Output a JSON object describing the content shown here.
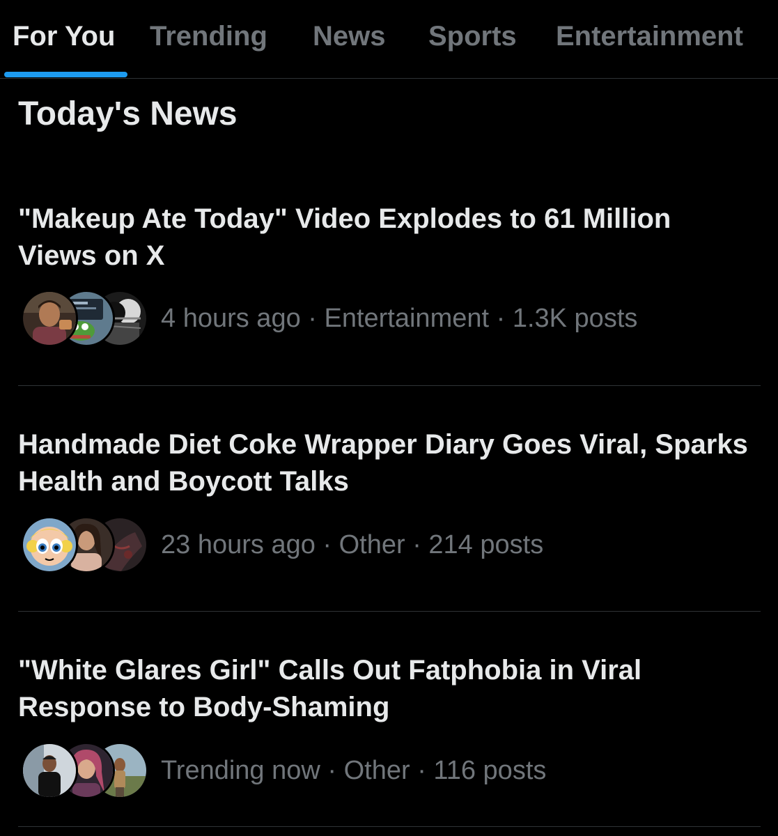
{
  "tabs": [
    {
      "label": "For You",
      "active": true
    },
    {
      "label": "Trending",
      "active": false
    },
    {
      "label": "News",
      "active": false
    },
    {
      "label": "Sports",
      "active": false
    },
    {
      "label": "Entertainment",
      "active": false
    }
  ],
  "colors": {
    "background": "#000000",
    "primary_text": "#e7e9ea",
    "secondary_text": "#71767b",
    "accent": "#1d9bf0",
    "divider": "#2f3336"
  },
  "section": {
    "title": "Today's News"
  },
  "news": [
    {
      "headline": "\"Makeup Ate Today\" Video Explodes to 61 Million Views on X",
      "meta": "4 hours ago · Entertainment · 1.3K posts",
      "time": "4 hours ago",
      "category": "Entertainment",
      "posts": "1.3K posts",
      "avatars": [
        "avatar-man-photo",
        "avatar-pepe-frog-screen",
        "avatar-dark-portrait"
      ]
    },
    {
      "headline": "Handmade Diet Coke Wrapper Diary Goes Viral, Sparks Health and Boycott Talks",
      "meta": "23 hours ago · Other · 214 posts",
      "time": "23 hours ago",
      "category": "Other",
      "posts": "214 posts",
      "avatars": [
        "avatar-bubbles-cartoon",
        "avatar-woman-photo",
        "avatar-dark-art"
      ]
    },
    {
      "headline": "\"White Glares Girl\" Calls Out Fatphobia in Viral Response to Body-Shaming",
      "meta": "Trending now · Other · 116 posts",
      "time": "Trending now",
      "category": "Other",
      "posts": "116 posts",
      "avatars": [
        "avatar-man-outdoor",
        "avatar-woman-pink-hair",
        "avatar-man-field"
      ]
    }
  ]
}
